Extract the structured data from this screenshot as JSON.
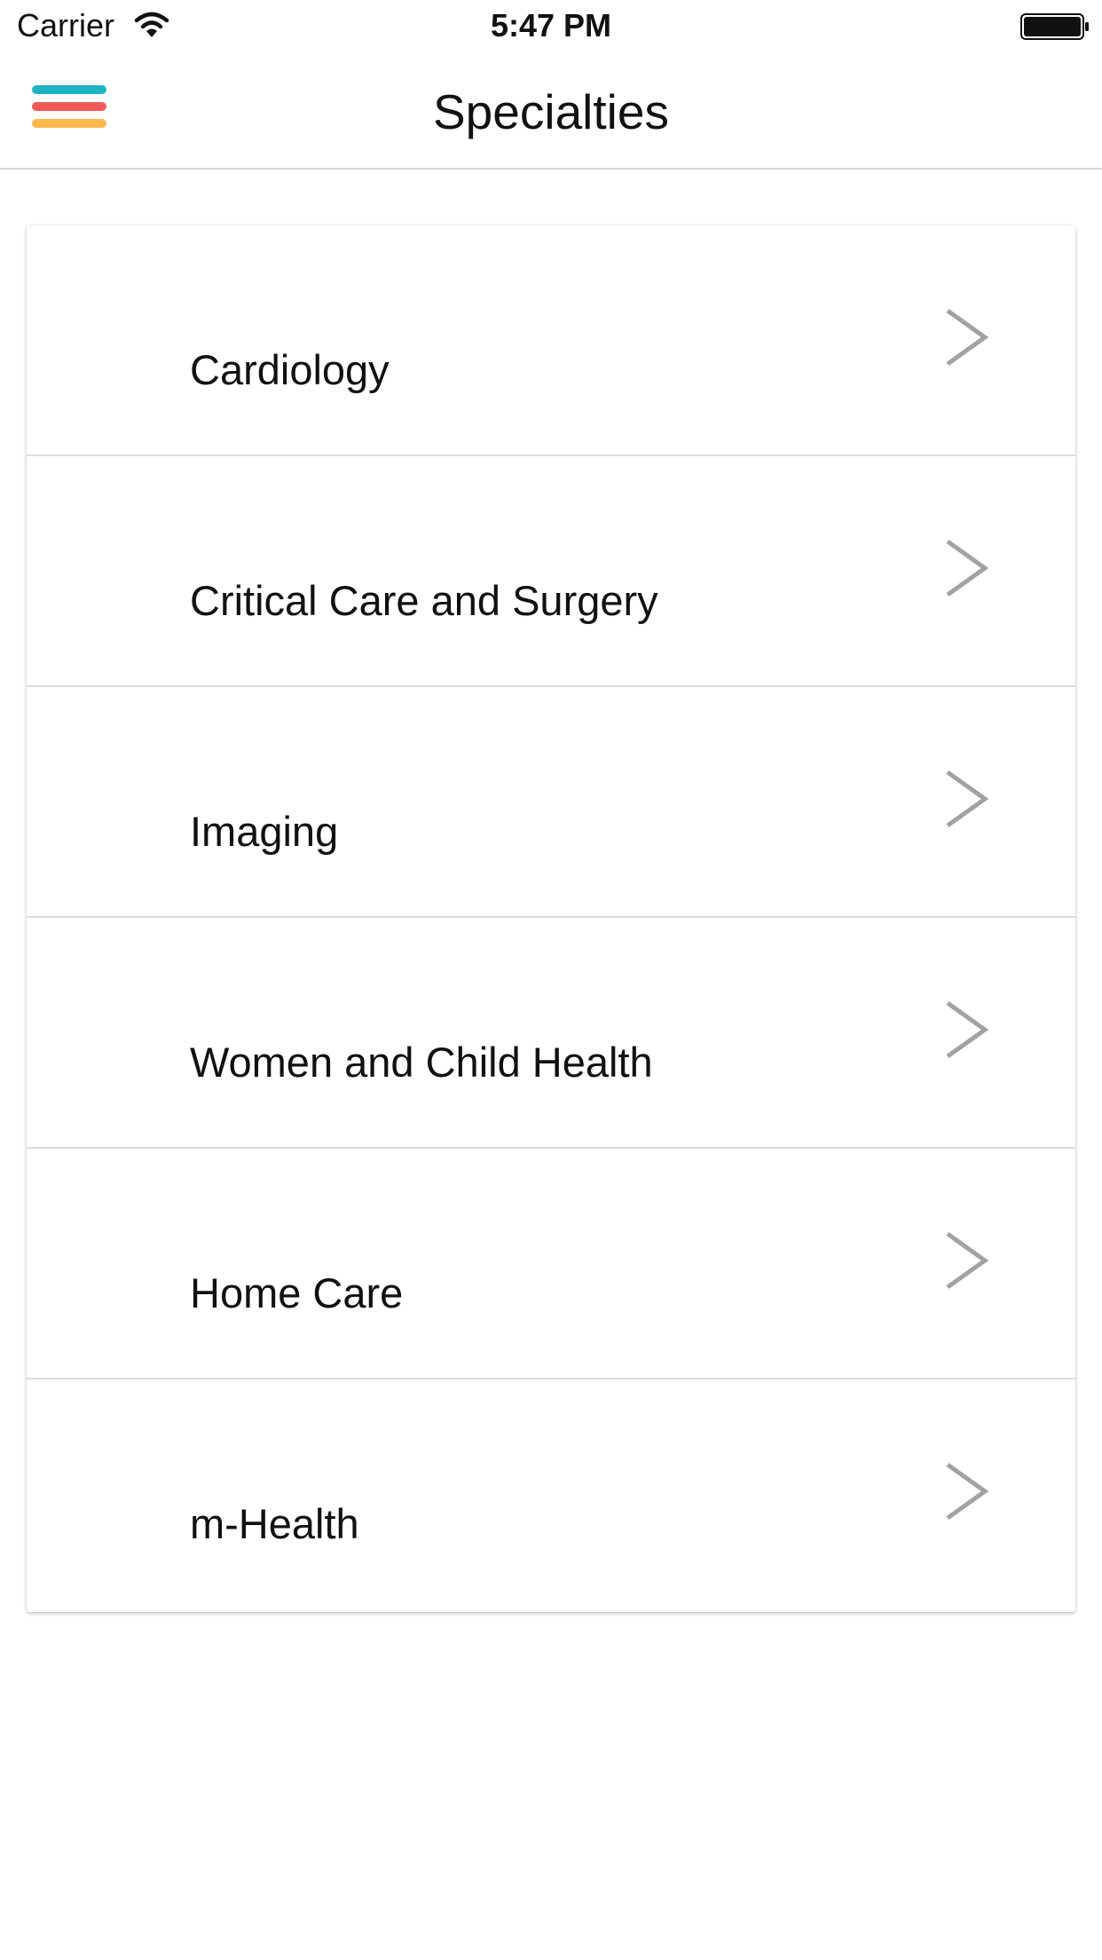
{
  "status_bar": {
    "carrier": "Carrier",
    "time": "5:47 PM",
    "wifi_icon": "wifi-icon",
    "battery_icon": "battery-icon"
  },
  "nav": {
    "title": "Specialties",
    "menu_icon": "hamburger-menu-icon",
    "menu_colors": [
      "#1eb3c2",
      "#f25a5a",
      "#ffb84d"
    ]
  },
  "specialties": [
    {
      "label": "Cardiology",
      "icon": "chevron-right-icon"
    },
    {
      "label": "Critical Care and Surgery",
      "icon": "chevron-right-icon"
    },
    {
      "label": "Imaging",
      "icon": "chevron-right-icon"
    },
    {
      "label": "Women and Child Health",
      "icon": "chevron-right-icon"
    },
    {
      "label": "Home Care",
      "icon": "chevron-right-icon"
    },
    {
      "label": "m-Health",
      "icon": "chevron-right-icon"
    }
  ]
}
